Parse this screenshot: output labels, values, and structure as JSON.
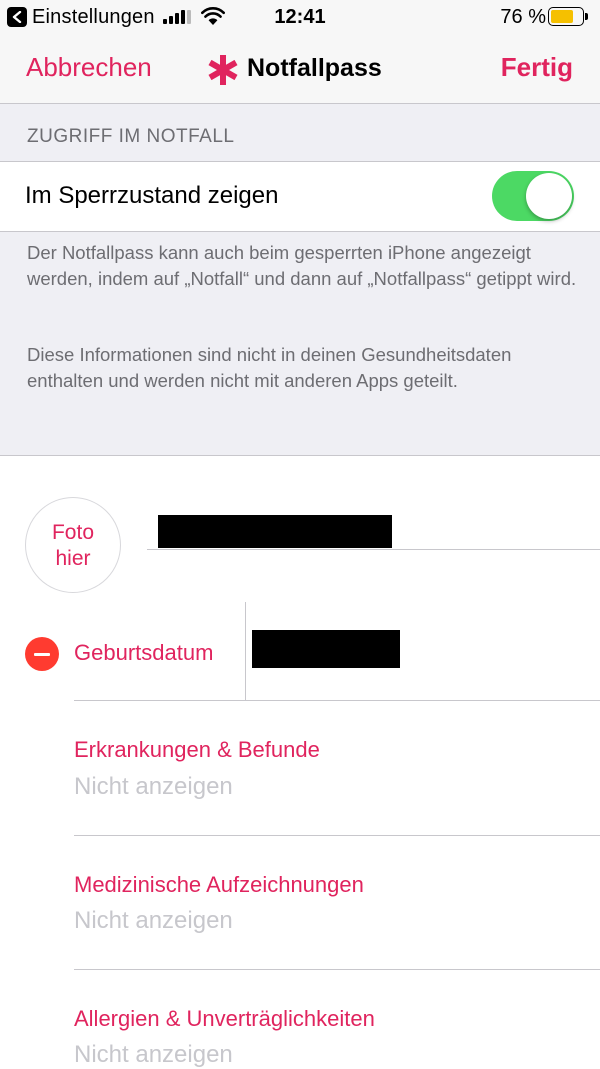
{
  "status_bar": {
    "back_label": "Einstellungen",
    "time": "12:41",
    "battery_percent": "76 %",
    "battery_level": 0.76,
    "battery_color": "#f5c000",
    "icons": [
      "back-arrow-icon",
      "cellular-signal-icon",
      "wifi-icon",
      "battery-icon"
    ]
  },
  "nav": {
    "cancel": "Abbrechen",
    "title": "Notfallpass",
    "done": "Fertig",
    "title_icon": "medical-star-icon",
    "accent_color": "#e0245e"
  },
  "lock_section": {
    "header": "ZUGRIFF IM NOTFALL",
    "toggle_label": "Im Sperrzustand zeigen",
    "toggle_on": true,
    "toggle_color": "#4cd964",
    "info_1": "Der Notfallpass kann auch beim gesperrten iPhone angezeigt werden, indem auf „Notfall“ und dann auf „Notfallpass“ getippt wird.",
    "info_2": "Diese Informationen sind nicht in deinen Gesundheitsdaten enthalten und werden nicht mit anderen Apps geteilt."
  },
  "profile": {
    "photo_line1": "Foto",
    "photo_line2": "hier",
    "birthdate_label": "Geburtsdatum"
  },
  "fields": [
    {
      "label": "Erkrankungen & Befunde",
      "value": "Nicht anzeigen"
    },
    {
      "label": "Medizinische Aufzeichnungen",
      "value": "Nicht anzeigen"
    },
    {
      "label": "Allergien & Unverträglichkeiten",
      "value": "Nicht anzeigen"
    }
  ]
}
